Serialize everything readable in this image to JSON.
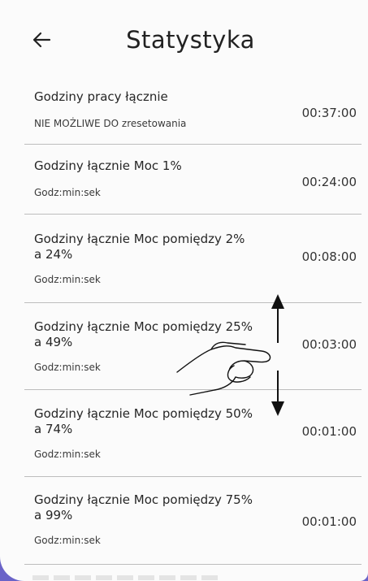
{
  "header": {
    "title": "Statystyka",
    "back_icon": "arrow-left-icon"
  },
  "rows": [
    {
      "title": "Godziny pracy łącznie",
      "subtitle": "NIE MOŻLIWE DO zresetowania",
      "value": "00:37:00"
    },
    {
      "title": "Godziny łącznie Moc 1%",
      "subtitle": "Godz:min:sek",
      "value": "00:24:00"
    },
    {
      "title": "Godziny łącznie Moc pomiędzy 2% a 24%",
      "subtitle": "Godz:min:sek",
      "value": "00:08:00"
    },
    {
      "title": "Godziny łącznie Moc pomiędzy 25% a 49%",
      "subtitle": "Godz:min:sek",
      "value": "00:03:00"
    },
    {
      "title": "Godziny łącznie Moc pomiędzy 50% a 74%",
      "subtitle": "Godz:min:sek",
      "value": "00:01:00"
    },
    {
      "title": "Godziny łącznie Moc pomiędzy 75% a 99%",
      "subtitle": "Godz:min:sek",
      "value": "00:01:00"
    }
  ],
  "gesture_icon": "swipe-vertical-hand-icon",
  "colors": {
    "frame_accent": "#6a63c8",
    "background": "#fbfbfb",
    "divider": "#bdbdbd",
    "text": "#262626"
  }
}
